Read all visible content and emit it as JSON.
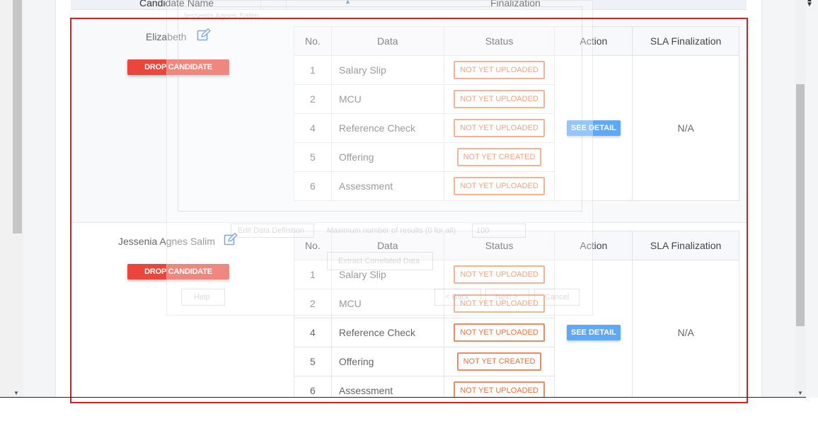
{
  "table_header": {
    "candidate_name": "Candidate Name",
    "finalization": "Finalization"
  },
  "columns": {
    "no": "No.",
    "data": "Data",
    "status": "Status",
    "action": "Action",
    "sla": "SLA Finalization"
  },
  "candidates": [
    {
      "name": "Elizabeth",
      "drop_label": "DROP CANDIDATE",
      "action_label": "SEE DETAIL",
      "sla": "N/A",
      "rows": [
        {
          "no": "1",
          "data": "Salary Slip",
          "status": "NOT YET UPLOADED"
        },
        {
          "no": "2",
          "data": "MCU",
          "status": "NOT YET UPLOADED"
        },
        {
          "no": "4",
          "data": "Reference Check",
          "status": "NOT YET UPLOADED"
        },
        {
          "no": "5",
          "data": "Offering",
          "status": "NOT YET CREATED"
        },
        {
          "no": "6",
          "data": "Assessment",
          "status": "NOT YET UPLOADED"
        }
      ]
    },
    {
      "name": "Jessenia Agnes Salim",
      "drop_label": "DROP CANDIDATE",
      "action_label": "SEE DETAIL",
      "sla": "N/A",
      "rows": [
        {
          "no": "1",
          "data": "Salary Slip",
          "status": "NOT YET UPLOADED"
        },
        {
          "no": "2",
          "data": "MCU",
          "status": "NOT YET UPLOADED"
        },
        {
          "no": "4",
          "data": "Reference Check",
          "status": "NOT YET UPLOADED"
        },
        {
          "no": "5",
          "data": "Offering",
          "status": "NOT YET CREATED"
        },
        {
          "no": "6",
          "data": "Assessment",
          "status": "NOT YET UPLOADED"
        }
      ]
    }
  ],
  "ghost_dialog": {
    "name_field": "Jessenia Agnes Salim",
    "edit_data_definition": "Edit Data Definition",
    "max_results_label": "Maximum number of results (0 for all)",
    "max_results_value": "100",
    "extract_button": "Extract Correlated Data",
    "help_button": "Help",
    "back_button": "< Back",
    "next_button": "Next >",
    "cancel_button": "Cancel"
  },
  "colors": {
    "drop_button": "#e9473b",
    "status_badge": "#f08a5d",
    "see_detail": "#5fa8f5",
    "highlight_frame": "#d71f1f"
  }
}
